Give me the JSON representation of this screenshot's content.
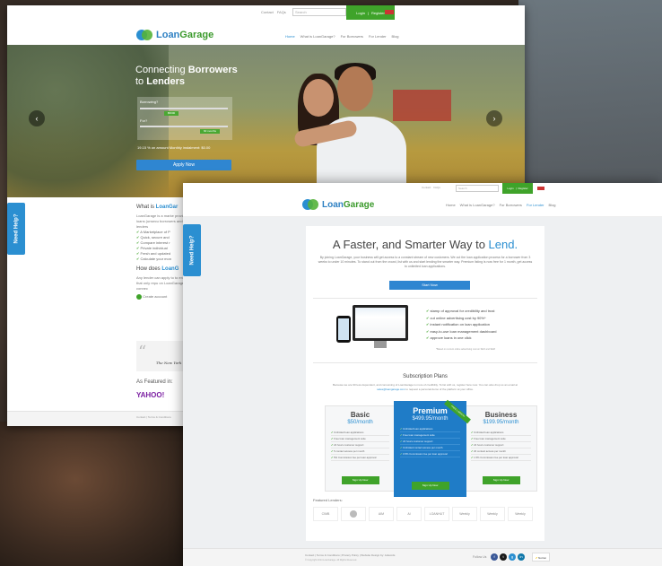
{
  "top_links": [
    "Contact",
    "FAQs"
  ],
  "search_placeholder": "Search",
  "login_label": "Login",
  "register_label": "Register",
  "logo": {
    "loan": "Loan",
    "garage": "Garage"
  },
  "shot1": {
    "nav": [
      "Home",
      "What is LoanGarage?",
      "For Borrowers",
      "For Lender",
      "Blog"
    ],
    "hero_title_line1": "Connecting ",
    "hero_title_bold1": "Borrowers",
    "hero_title_line2": "to ",
    "hero_title_bold2": "Lenders",
    "borrowing_label": "Borrowing?",
    "borrowing_value": "$5000",
    "for_label": "For?",
    "for_value": "60 months",
    "monthly_text": "19.15 % on amount Monthly instalment: $0.00",
    "apply_label": "Apply Now",
    "what_is_heading": "What is ",
    "what_is_brand": "LoanGar",
    "what_is_text": "LoanGarage is a marke provide loans (unsecu borrowers and lenders",
    "checklist": [
      "A Marketplace of P",
      "Quick, secure and",
      "Compare interest r",
      "Private individual",
      "Fresh and updated",
      "Calculate your mon"
    ],
    "how_heading": "How does ",
    "how_brand": "LoanG",
    "how_text": "Any lender can apply to to ensure that only repu on LoanGarage connec",
    "create_account": "Create account",
    "quote_source": "The New York T",
    "featured_label": "As Featured in:",
    "yahoo": "YAHOO!",
    "footer_text": "Contact | Terms & Conditions"
  },
  "need_help": "Need Help?",
  "shot2": {
    "nav": [
      "Home",
      "What is LoanGarage?",
      "For Borrowers",
      "For Lender",
      "Blog"
    ],
    "active_nav": "For Lender",
    "title_prefix": "A Faster, and Smarter Way to ",
    "title_highlight": "Lend.",
    "intro": "By joining LoanGarage, your business will get access to a constant stream of new customers. We cut the loan application process for a borrower from 3 weeks to under 10 minutes. To stand out from the crowd, list with us and start lending the smarter way. Premium listing is now free for 1 month, get access to unlimited loan applications.",
    "start_label": "Start Now",
    "benefits": [
      "stamp of approval for credibility and trust",
      "cut online advertising cost by 90%*",
      "instant notification on loan application",
      "easy-to-use loan management dashboard",
      "approve loans in one click"
    ],
    "benefit_note": "*Based on current online advertising cost on SEO and SEM",
    "subscription_title": "Subscription Plans",
    "subscription_intro": "Because we are 90 less dependent, and consuming of LoanGarage is more of credibility. To list with us, register here now. You can also drop us an email at ",
    "subscription_email": "sales@loangarage.com",
    "subscription_intro_end": " to request a personal demo of the platform at your office.",
    "plans": [
      {
        "name": "Basic",
        "price": "$50/month",
        "features": [
          "Unlimited loan applications",
          "Free loan management suite",
          "24 hours customer support",
          "5 contact access per month",
          "5% Commission fee per loan approval"
        ],
        "button": "Sign Up Now"
      },
      {
        "name": "Premium",
        "price": "$499.95/month",
        "ribbon": "FREE 1 MONTH",
        "features": [
          "Unlimited loan applications",
          "Free loan management suite",
          "24 hours customer support",
          "Unlimited contact access per month",
          "0.5% Commission fee per loan approval"
        ],
        "button": "Sign Up Now"
      },
      {
        "name": "Business",
        "price": "$199.95/month",
        "features": [
          "Unlimited loan applications",
          "Free loan management suite",
          "24 hours customer support",
          "20 contact access per month",
          "1.5% Commission fee per loan approval"
        ],
        "button": "Sign Up Now"
      }
    ],
    "featured_lenders_label": "Featured Lenders:",
    "lenders": [
      "CIMB",
      "",
      "AIM",
      "AI",
      "LOANHUT",
      "Weekly",
      "Weekly",
      "Weekly"
    ],
    "footer_links": "Contact | Terms & Conditions | Privacy Policy | Website Design by: Adwords",
    "footer_copy": "© Copyright 2014 LoanGarage. All Rights Reserved.",
    "follow_label": "Follow Us",
    "norton_label": "Norton"
  }
}
